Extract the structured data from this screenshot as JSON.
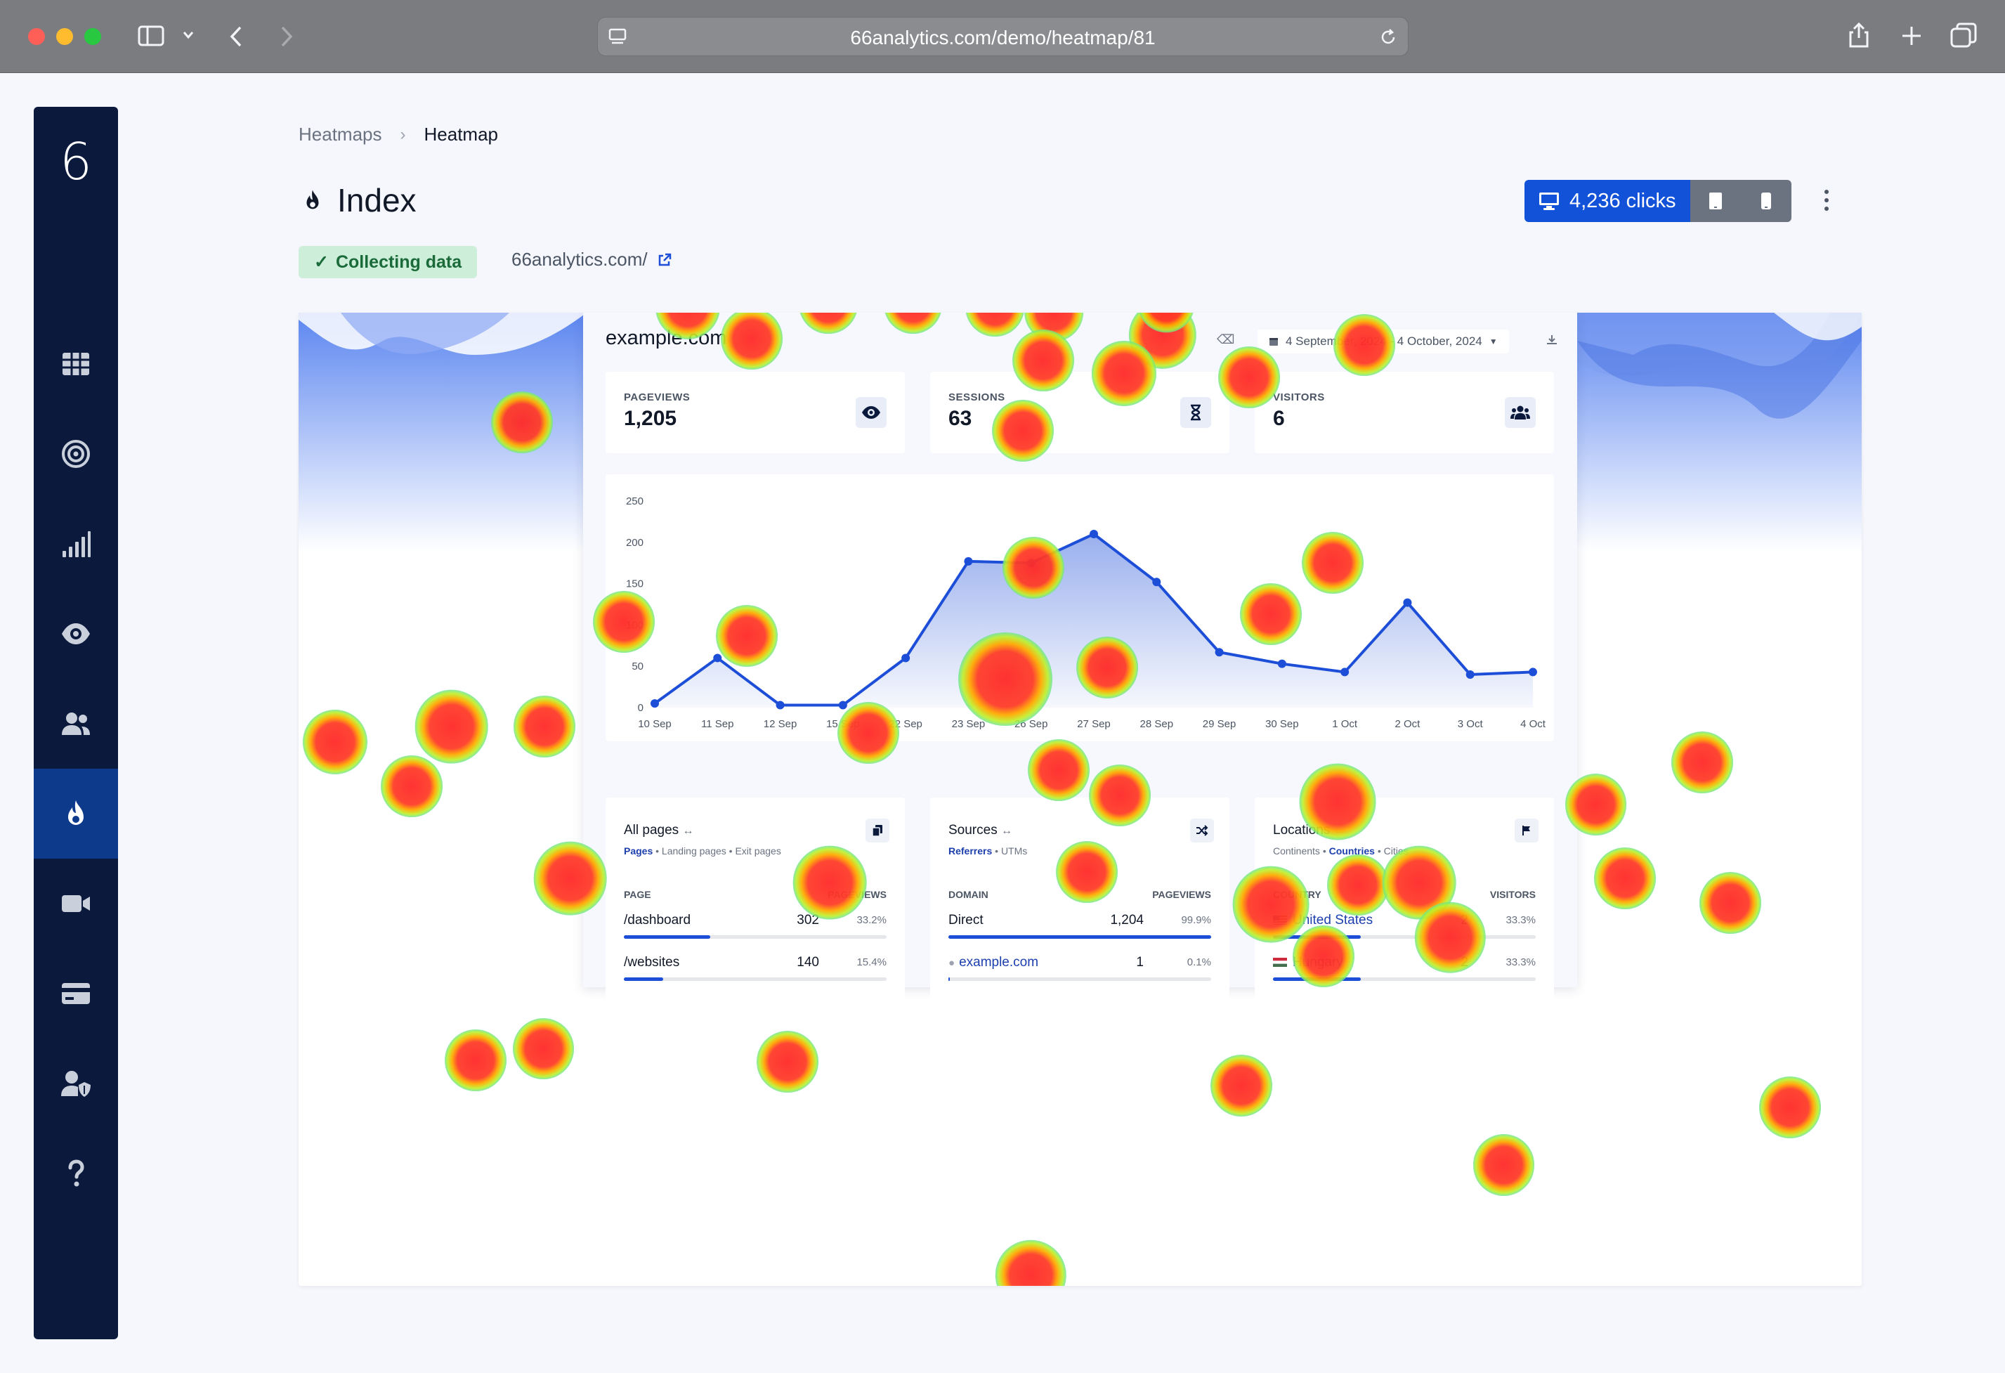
{
  "browser": {
    "url": "66analytics.com/demo/heatmap/81"
  },
  "sidebar": {
    "logo": "6",
    "items": [
      {
        "name": "dashboard",
        "icon": "grid-icon"
      },
      {
        "name": "goals",
        "icon": "target-icon"
      },
      {
        "name": "analytics",
        "icon": "signal-bars-icon"
      },
      {
        "name": "realtime",
        "icon": "eye-icon"
      },
      {
        "name": "visitors",
        "icon": "users-icon"
      },
      {
        "name": "heatmaps",
        "icon": "fire-icon",
        "active": true
      },
      {
        "name": "replays",
        "icon": "video-icon"
      },
      {
        "name": "billing",
        "icon": "credit-card-icon"
      },
      {
        "name": "team",
        "icon": "user-shield-icon"
      },
      {
        "name": "help",
        "icon": "question-icon"
      }
    ]
  },
  "breadcrumb": {
    "parent": "Heatmaps",
    "current": "Heatmap"
  },
  "page": {
    "title": "Index",
    "status": "Collecting data",
    "site_link": "66analytics.com/",
    "clicks_label": "4,236 clicks"
  },
  "snapshot": {
    "domain": "example.com",
    "date_range": "4 September, 2024 - 4 October, 2024",
    "stats": [
      {
        "label": "PAGEVIEWS",
        "value": "1,205",
        "icon": "eye-icon"
      },
      {
        "label": "SESSIONS",
        "value": "63",
        "icon": "hourglass-icon"
      },
      {
        "label": "VISITORS",
        "value": "6",
        "icon": "users-icon"
      }
    ],
    "cards": {
      "pages": {
        "title": "All pages",
        "sub_a": "Pages",
        "sub_b": " • Landing pages • Exit pages",
        "col_a": "PAGE",
        "col_b": "PAGEVIEWS",
        "rows": [
          {
            "name": "/dashboard",
            "num": "302",
            "pct": "33.2%",
            "fill": 0.33
          },
          {
            "name": "/websites",
            "num": "140",
            "pct": "15.4%",
            "fill": 0.15
          }
        ]
      },
      "sources": {
        "title": "Sources",
        "sub_a": "Referrers",
        "sub_b": " • UTMs",
        "col_a": "DOMAIN",
        "col_b": "PAGEVIEWS",
        "rows": [
          {
            "name": "Direct",
            "num": "1,204",
            "pct": "99.9%",
            "fill": 0.999
          },
          {
            "name": "example.com",
            "num": "1",
            "pct": "0.1%",
            "fill": 0.001
          }
        ]
      },
      "locations": {
        "title": "Locations",
        "sub_a": "Continents • ",
        "sub_b": "Countries",
        "sub_c": " • Cities",
        "col_a": "COUNTRY",
        "col_b": "VISITORS",
        "rows": [
          {
            "name": "United States",
            "num": "2",
            "pct": "33.3%",
            "fill": 0.333
          },
          {
            "name": "Hungary",
            "num": "2",
            "pct": "33.3%",
            "fill": 0.333
          }
        ]
      }
    }
  },
  "chart_data": {
    "type": "area",
    "categories": [
      "10 Sep",
      "11 Sep",
      "12 Sep",
      "15 Sep",
      "22 Sep",
      "23 Sep",
      "26 Sep",
      "27 Sep",
      "28 Sep",
      "29 Sep",
      "30 Sep",
      "1 Oct",
      "2 Oct",
      "3 Oct",
      "4 Oct"
    ],
    "values": [
      5,
      60,
      3,
      3,
      60,
      177,
      175,
      210,
      152,
      67,
      53,
      43,
      127,
      40,
      43
    ],
    "ylim": [
      0,
      250
    ],
    "yticks": [
      0,
      50,
      100,
      150,
      200,
      250
    ],
    "color": "#1d4ed8"
  },
  "heat": {
    "spot_count": 52
  }
}
